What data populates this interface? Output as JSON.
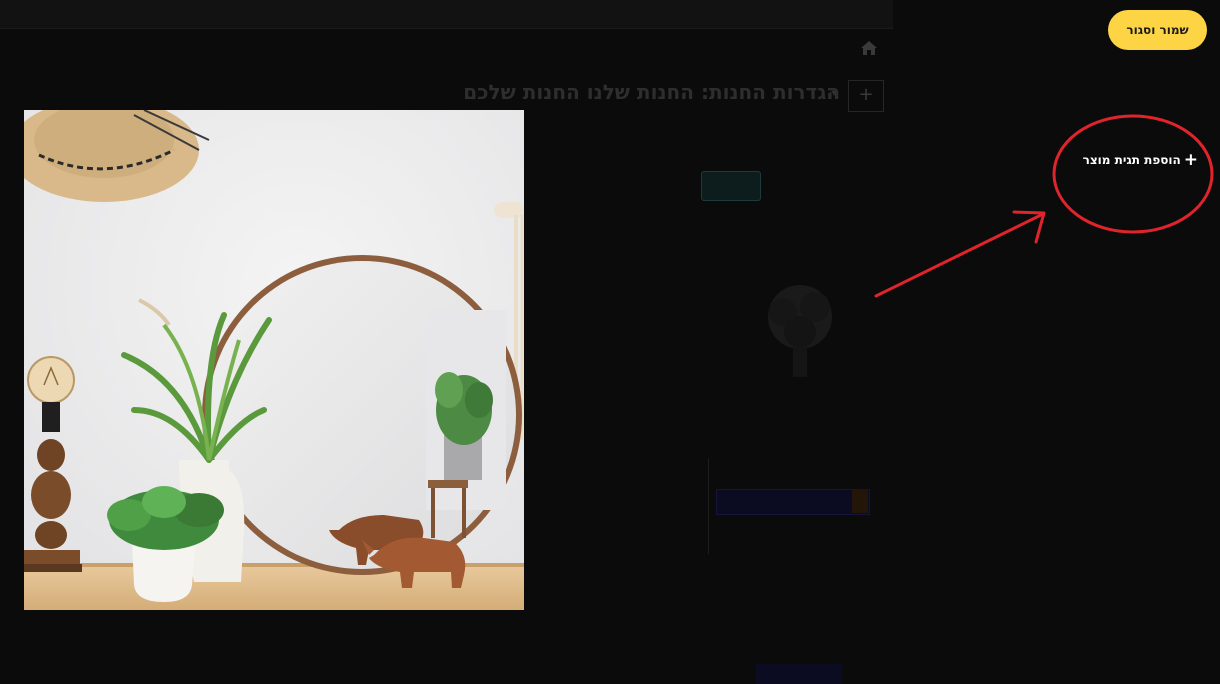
{
  "toolbar": {
    "save_close_label": "שמור וסגור",
    "add_product_tag_label": "הוספת תגית מוצר",
    "add_icon": "plus-icon"
  },
  "colors": {
    "save_button": "#fdd443",
    "annotation": "#e0242b",
    "overlay": "#0b0b0b"
  },
  "background_page": {
    "heading": "הגדרות החנות: החנות שלנו החנות שלכם"
  }
}
